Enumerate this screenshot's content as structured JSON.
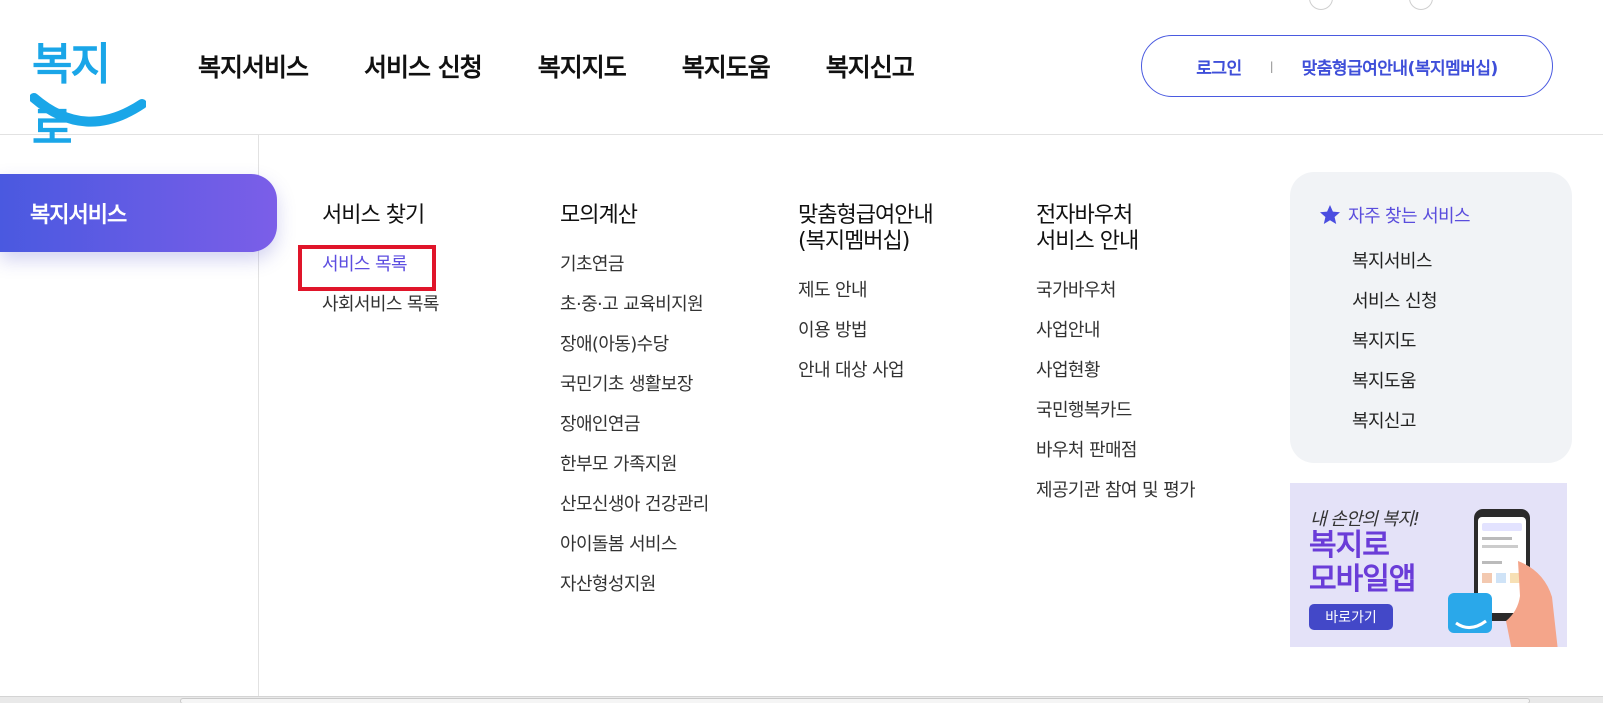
{
  "logo": {
    "text": "복지로"
  },
  "gnb": [
    "복지서비스",
    "서비스 신청",
    "복지지도",
    "복지도움",
    "복지신고"
  ],
  "user_menu": {
    "login": "로그인",
    "separator": "ㅣ",
    "membership": "맞춤형급여안내(복지멤버십)"
  },
  "side": {
    "active_label": "복지서비스"
  },
  "columns": [
    {
      "title": "서비스 찾기",
      "items": [
        "서비스 목록",
        "사회서비스 목록"
      ]
    },
    {
      "title": "모의계산",
      "items": [
        "기초연금",
        "초·중·고 교육비지원",
        "장애(아동)수당",
        "국민기초 생활보장",
        "장애인연금",
        "한부모 가족지원",
        "산모신생아 건강관리",
        "아이돌봄 서비스",
        "자산형성지원"
      ]
    },
    {
      "title": "맞춤형급여안내\n(복지멤버십)",
      "items": [
        "제도 안내",
        "이용 방법",
        "안내 대상 사업"
      ]
    },
    {
      "title": "전자바우처\n서비스 안내",
      "items": [
        "국가바우처",
        "사업안내",
        "사업현황",
        "국민행복카드",
        "바우처 판매점",
        "제공기관 참여 및 평가"
      ]
    }
  ],
  "favorites": {
    "title": "자주 찾는 서비스",
    "icon": "star-icon",
    "items": [
      "복지서비스",
      "서비스 신청",
      "복지지도",
      "복지도움",
      "복지신고"
    ]
  },
  "banner": {
    "line1": "내 손안의 복지!",
    "line2": "복지로\n모바일앱",
    "button": "바로가기"
  },
  "colors": {
    "accent": "#4a5ae0",
    "purple": "#7b5ee8",
    "highlight": "#e0152a",
    "active_link": "#5c4de0"
  }
}
